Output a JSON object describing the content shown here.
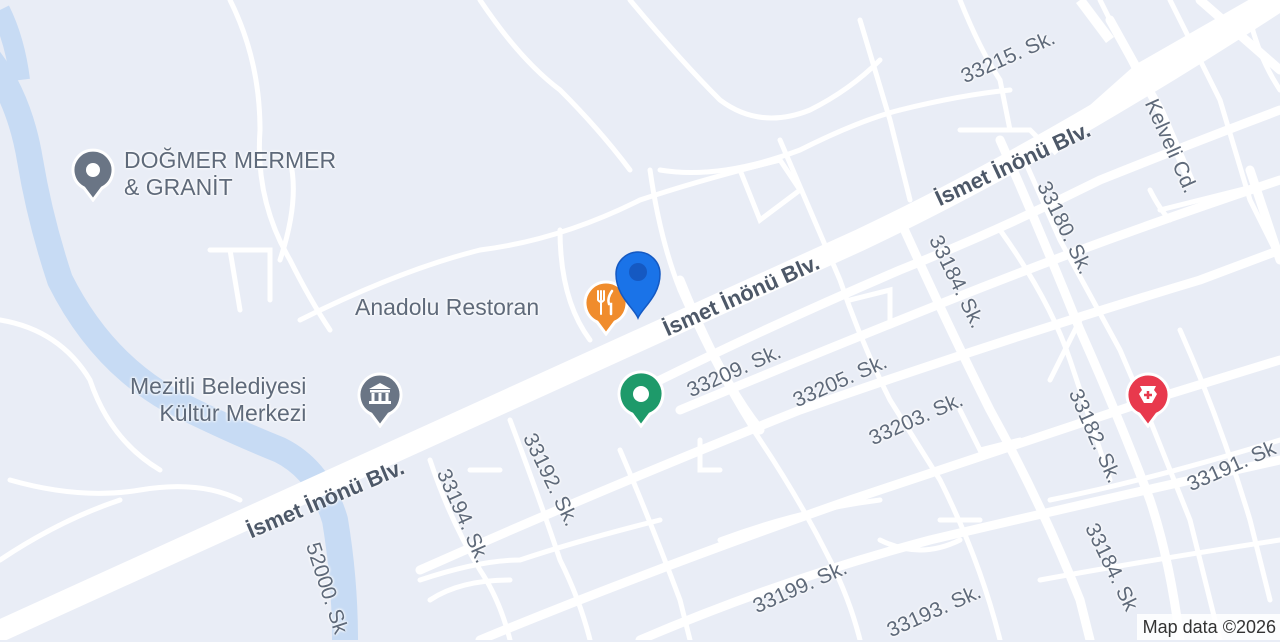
{
  "colors": {
    "background": "#e9edf6",
    "road": "#ffffff",
    "water": "#c7dbf4",
    "restaurant": "#f08c2c",
    "park": "#1e9a6a",
    "pharmacy": "#e8394d",
    "location": "#1a73e8",
    "landmark": "#6a7585"
  },
  "roads": {
    "boulevard_1": "İsmet İnönü Blv.",
    "boulevard_2": "İsmet İnönü Blv.",
    "boulevard_3": "İsmet İnönü Blv.",
    "s33215": "33215. Sk.",
    "kelveli": "Kelveli Cd.",
    "s33180": "33180. Sk.",
    "s33184a": "33184. Sk.",
    "s33209": "33209. Sk.",
    "s33205": "33205. Sk.",
    "s33203": "33203. Sk.",
    "s33182": "33182. Sk.",
    "s33191": "33191. Sk",
    "s33192": "33192. Sk.",
    "s33194": "33194. Sk.",
    "s52000": "52000. Sk",
    "s33199": "33199. Sk.",
    "s33193": "33193. Sk.",
    "s33184b": "33184. Sk"
  },
  "pois": {
    "dogmer_line1": "DOĞMER MERMER",
    "dogmer_line2": "& GRANİT",
    "anadolu": "Anadolu Restoran",
    "mezitli_line1": "Mezitli Belediyesi",
    "mezitli_line2": "Kültür Merkezi"
  },
  "icons": {
    "dogmer": "place-pin-icon",
    "anadolu": "restaurant-icon",
    "mezitli": "museum-icon",
    "park": "park-pin-icon",
    "pharmacy": "pharmacy-icon",
    "location": "location-marker-icon"
  },
  "attribution": "Map data ©2026"
}
